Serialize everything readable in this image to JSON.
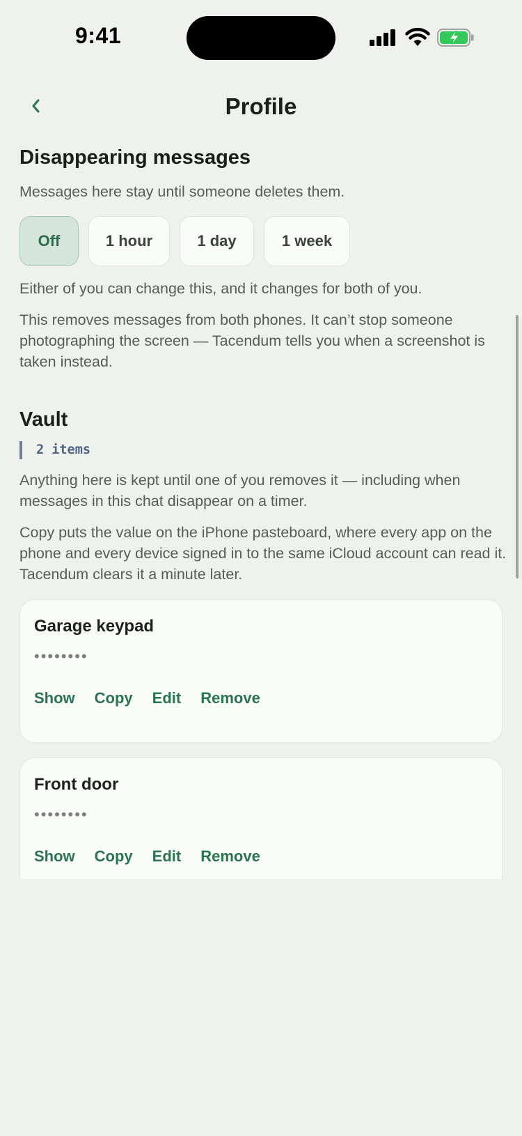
{
  "status_bar": {
    "time": "9:41"
  },
  "nav": {
    "title": "Profile"
  },
  "disappearing": {
    "title": "Disappearing messages",
    "description": "Messages here stay until someone deletes them.",
    "options": [
      "Off",
      "1 hour",
      "1 day",
      "1 week"
    ],
    "selected": "Off",
    "note_1": "Either of you can change this, and it changes for both of you.",
    "note_2": "This removes messages from both phones. It can’t stop someone photographing the screen — Tacendum tells you when a screenshot is taken instead."
  },
  "vault": {
    "title": "Vault",
    "count": "2 items",
    "note_1": "Anything here is kept until one of you removes it — including when messages in this chat disappear on a timer.",
    "note_2": "Copy puts the value on the iPhone pasteboard, where every app on the phone and every device signed in to the same iCloud account can read it. Tacendum clears it a minute later.",
    "items": [
      {
        "title": "Garage keypad",
        "masked": "••••••••"
      },
      {
        "title": "Front door",
        "masked": "••••••••"
      }
    ],
    "actions": {
      "show": "Show",
      "copy": "Copy",
      "edit": "Edit",
      "remove": "Remove"
    }
  },
  "colors": {
    "background": "#eff1ec",
    "accent": "#2a7353",
    "selected_chip": "#d5e5db",
    "badge": "#4f6384"
  }
}
